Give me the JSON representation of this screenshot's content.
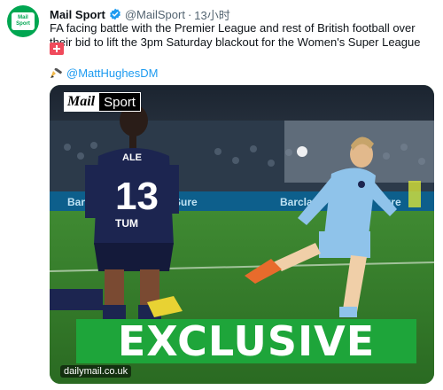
{
  "tweet": {
    "author": {
      "display_name": "Mail Sport",
      "handle": "@MailSport",
      "avatar_text_top": "Mail",
      "avatar_text_bottom": "Sport"
    },
    "separator": "·",
    "time": "13小时",
    "text": "FA facing battle with the Premier League and rest of British football over their bid to lift the 3pm Saturday blackout for the Women's Super League",
    "mention": "@MattHughesDM",
    "icons": [
      "verified-badge-icon",
      "england-flag-icon",
      "writing-hand-icon"
    ],
    "colors": {
      "link": "#1d9bf0",
      "verified": "#1d9bf0",
      "brand_green": "#00a651"
    }
  },
  "media": {
    "watermark_mail": "Mail",
    "watermark_sport": "Sport",
    "player_name": "ALE",
    "player_number": "13",
    "sponsor": "TUM",
    "banner_text": "EXCLUSIVE",
    "source_label": "dailymail.co.uk",
    "banner_color": "#1ea53a"
  }
}
